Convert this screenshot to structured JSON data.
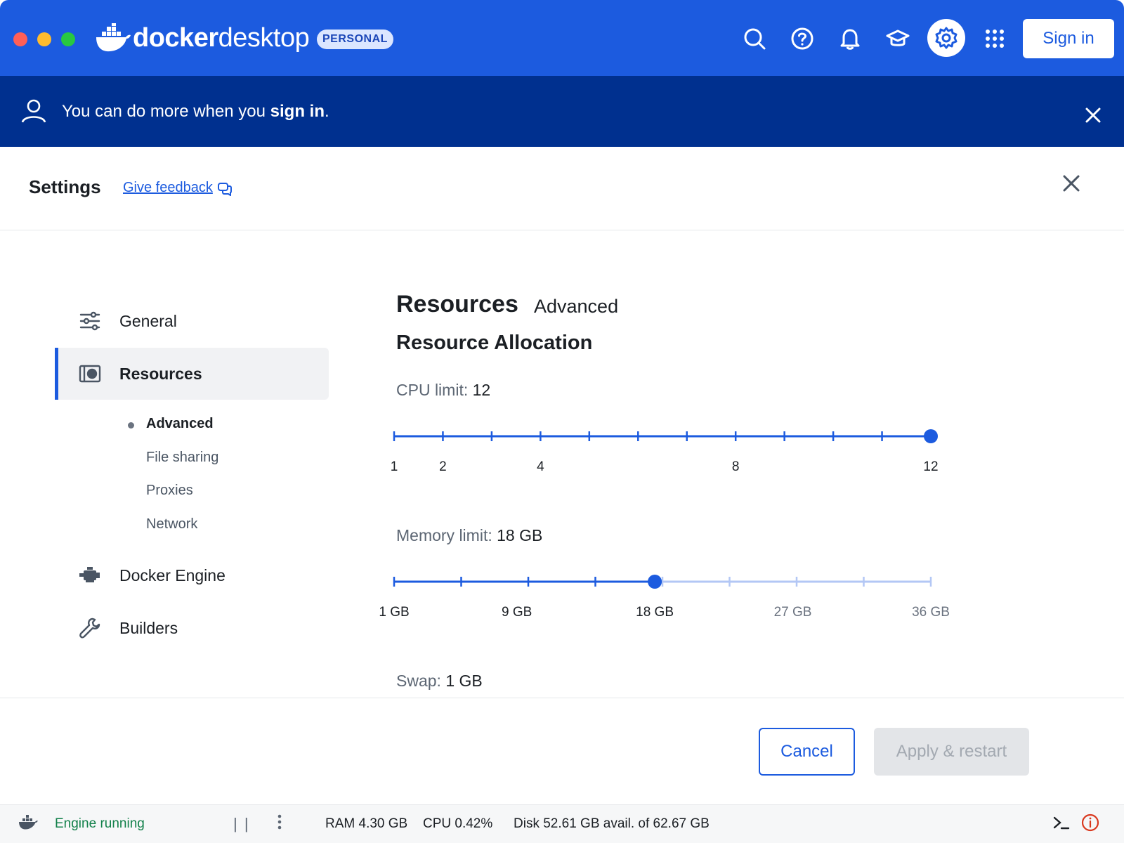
{
  "window": {
    "brand_prefix": "docker",
    "brand_suffix": "desktop",
    "plan_badge": "PERSONAL",
    "sign_in_label": "Sign in",
    "colors": {
      "titlebar": "#1c5bdf",
      "banner": "#00308f",
      "accent": "#1c5bdf"
    },
    "toolbar_icons": [
      "search-icon",
      "help-icon",
      "bell-icon",
      "learning-icon",
      "gear-icon",
      "apps-grid-icon"
    ]
  },
  "banner": {
    "text_before": "You can do more when you",
    "link_text": "sign in",
    "text_after": "."
  },
  "settings": {
    "title": "Settings",
    "feedback_label": "Give feedback"
  },
  "sidebar": {
    "items": [
      {
        "label": "General",
        "icon": "sliders-icon"
      },
      {
        "label": "Resources",
        "icon": "resources-icon",
        "active": true
      },
      {
        "label": "Docker Engine",
        "icon": "engine-icon"
      },
      {
        "label": "Builders",
        "icon": "wrench-icon"
      }
    ],
    "sub_items": [
      {
        "label": "Advanced",
        "active": true
      },
      {
        "label": "File sharing"
      },
      {
        "label": "Proxies"
      },
      {
        "label": "Network"
      }
    ]
  },
  "main": {
    "heading": "Resources",
    "subheading": "Advanced",
    "section_title": "Resource Allocation",
    "cpu": {
      "label": "CPU limit:",
      "value": "12",
      "min": 1,
      "max": 12,
      "current": 12,
      "tick_labels": [
        {
          "value": 1,
          "text": "1"
        },
        {
          "value": 2,
          "text": "2"
        },
        {
          "value": 4,
          "text": "4"
        },
        {
          "value": 8,
          "text": "8"
        },
        {
          "value": 12,
          "text": "12"
        }
      ]
    },
    "memory": {
      "label": "Memory limit:",
      "value": "18 GB",
      "min": 1,
      "max": 36,
      "current": 18,
      "tick_labels": [
        {
          "value": 1,
          "text": "1 GB"
        },
        {
          "value": 9,
          "text": "9 GB"
        },
        {
          "value": 18,
          "text": "18 GB"
        },
        {
          "value": 27,
          "text": "27 GB"
        },
        {
          "value": 36,
          "text": "36 GB"
        }
      ]
    },
    "swap": {
      "label": "Swap:",
      "value": "1 GB"
    }
  },
  "footer": {
    "cancel_label": "Cancel",
    "apply_label": "Apply & restart"
  },
  "status": {
    "engine": "Engine running",
    "pause": "| |",
    "ram": "RAM 4.30 GB",
    "cpu": "CPU 0.42%",
    "disk": "Disk 52.61 GB avail. of 62.67 GB"
  }
}
